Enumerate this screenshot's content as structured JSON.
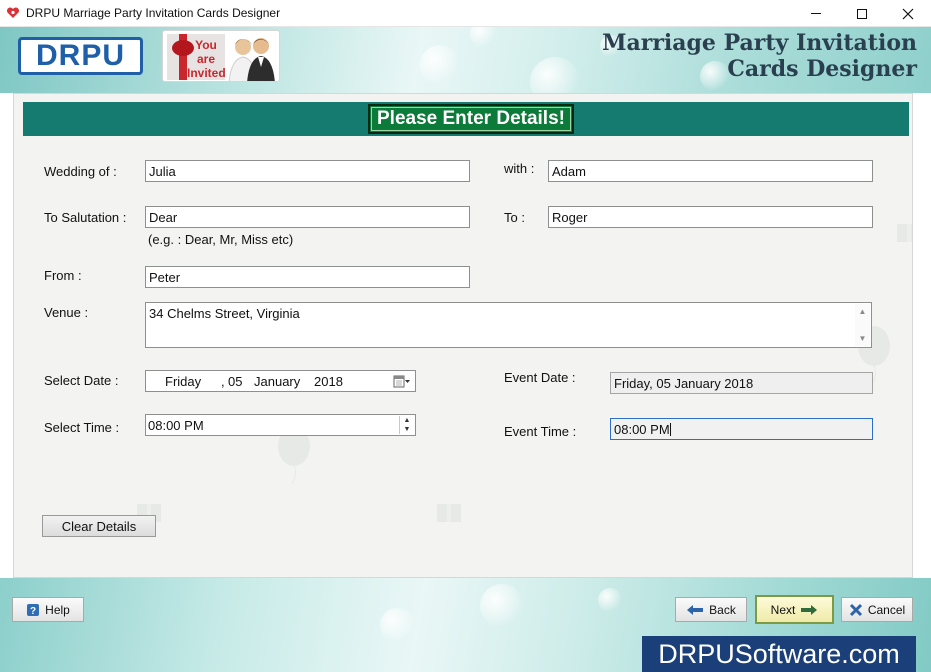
{
  "window": {
    "title": "DRPU Marriage Party Invitation Cards Designer"
  },
  "header": {
    "logo_text": "DRPU",
    "badge_text": [
      "You",
      "are",
      "Invited"
    ],
    "app_title_line1": "Marriage Party Invitation",
    "app_title_line2": "Cards Designer"
  },
  "form": {
    "section_title": "Please Enter Details!",
    "wedding_of": {
      "label": "Wedding of :",
      "value": "Julia"
    },
    "with": {
      "label": "with :",
      "value": "Adam"
    },
    "to_salutation": {
      "label": "To Salutation :",
      "value": "Dear",
      "hint": "(e.g. : Dear, Mr, Miss etc)"
    },
    "to": {
      "label": "To :",
      "value": "Roger"
    },
    "from": {
      "label": "From :",
      "value": "Peter"
    },
    "venue": {
      "label": "Venue :",
      "value": "34 Chelms Street, Virginia"
    },
    "select_date": {
      "label": "Select Date :",
      "day_name": "Friday",
      "separator": ",",
      "day": "05",
      "month": "January",
      "year": "2018"
    },
    "event_date": {
      "label": "Event Date :",
      "value": "Friday, 05 January 2018"
    },
    "select_time": {
      "label": "Select Time :",
      "value": "08:00 PM"
    },
    "event_time": {
      "label": "Event Time :",
      "value": "08:00 PM"
    },
    "clear_button": "Clear Details"
  },
  "footer": {
    "help": "Help",
    "back": "Back",
    "next": "Next",
    "cancel": "Cancel",
    "brand": "DRPUSoftware.com"
  },
  "icons": {
    "help": "help-icon",
    "back": "arrow-left-icon",
    "next": "arrow-right-icon",
    "cancel": "cancel-x-icon",
    "calendar": "calendar-icon"
  },
  "colors": {
    "section_bar": "#157a70",
    "section_title_bg": "#0c7a38",
    "brand_banner": "#1b3f78",
    "logo_blue": "#1e5fa8"
  }
}
